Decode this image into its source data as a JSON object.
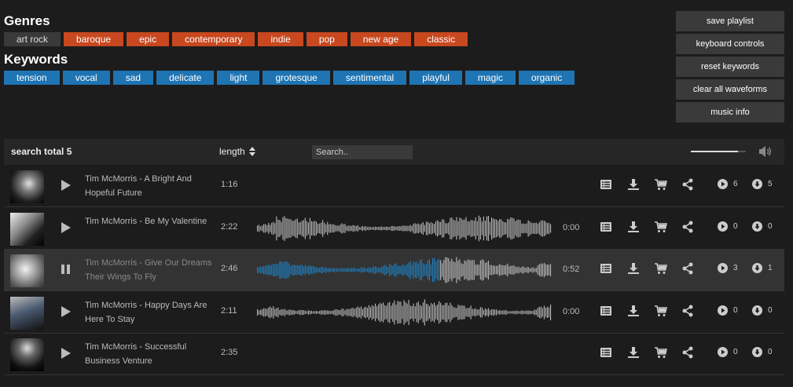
{
  "genres": {
    "title": "Genres",
    "items": [
      {
        "label": "art rock",
        "active": true
      },
      {
        "label": "baroque",
        "active": false
      },
      {
        "label": "epic",
        "active": false
      },
      {
        "label": "contemporary",
        "active": false
      },
      {
        "label": "indie",
        "active": false
      },
      {
        "label": "pop",
        "active": false
      },
      {
        "label": "new age",
        "active": false
      },
      {
        "label": "classic",
        "active": false
      }
    ]
  },
  "keywords": {
    "title": "Keywords",
    "items": [
      "tension",
      "vocal",
      "sad",
      "delicate",
      "light",
      "grotesque",
      "sentimental",
      "playful",
      "magic",
      "organic"
    ]
  },
  "side_buttons": [
    "save playlist",
    "keyboard controls",
    "reset keywords",
    "clear all waveforms",
    "music info"
  ],
  "list_header": {
    "total_label": "search total 5",
    "length_label": "length",
    "search_placeholder": "Search..",
    "volume": 0.85
  },
  "tracks": [
    {
      "title": "Tim McMorris - A Bright And Hopeful Future",
      "duration": "1:16",
      "position": "",
      "waveform": false,
      "progress": 0,
      "playing": false,
      "plays": "6",
      "downloads": "5"
    },
    {
      "title": "Tim McMorris - Be My Valentine",
      "duration": "2:22",
      "position": "0:00",
      "waveform": true,
      "progress": 0,
      "playing": false,
      "plays": "0",
      "downloads": "0"
    },
    {
      "title": "Tim McMorris - Give Our Dreams Their Wings To Fly",
      "duration": "2:46",
      "position": "0:52",
      "waveform": true,
      "progress": 0.62,
      "playing": true,
      "plays": "3",
      "downloads": "1"
    },
    {
      "title": "Tim McMorris - Happy Days Are Here To Stay",
      "duration": "2:11",
      "position": "0:00",
      "waveform": true,
      "progress": 0,
      "playing": false,
      "plays": "0",
      "downloads": "0"
    },
    {
      "title": "Tim McMorris - Successful Business Venture",
      "duration": "2:35",
      "position": "",
      "waveform": false,
      "progress": 0,
      "playing": false,
      "plays": "0",
      "downloads": "0"
    }
  ],
  "icons": {
    "track_actions": [
      "list-icon",
      "download-icon",
      "cart-icon",
      "share-icon"
    ],
    "plays": "play-circle-icon",
    "downloads": "download-circle-icon",
    "volume": "volume-icon",
    "sort": "sort-icon"
  },
  "colors": {
    "genre_tag": "#c8481f",
    "keyword_tag": "#1f74b3",
    "waveform_played": "#1f82c4",
    "waveform": "#bdbdbd"
  }
}
